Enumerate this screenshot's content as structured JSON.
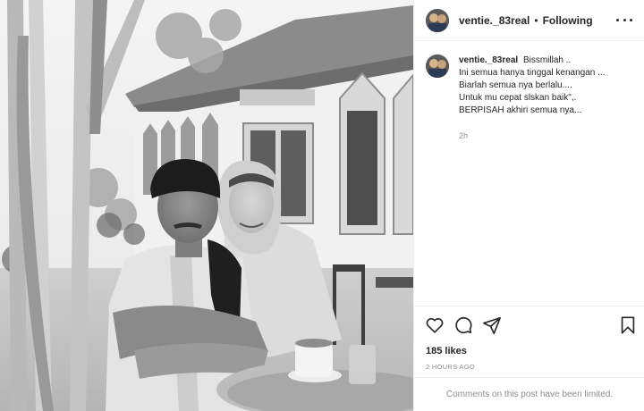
{
  "header": {
    "username": "ventie._83real",
    "separator": "•",
    "follow_label": "Following",
    "more_icon": "more-dots-icon"
  },
  "caption": {
    "username": "ventie._83real",
    "lines": [
      "Bissmillah ..",
      "Ini semua hanya tinggal kenangan ...",
      "Biarlah semua nya berlalu....",
      "Untuk mu cepat slskan baik\",.",
      "BERPISAH akhiri semua nya..."
    ],
    "relative_time": "2h"
  },
  "actions": {
    "like_icon": "heart-icon",
    "comment_icon": "comment-icon",
    "share_icon": "share-icon",
    "save_icon": "bookmark-icon"
  },
  "stats": {
    "likes": "185 likes",
    "posted": "2 HOURS AGO"
  },
  "comments": {
    "notice": "Comments on this post have been limited."
  }
}
